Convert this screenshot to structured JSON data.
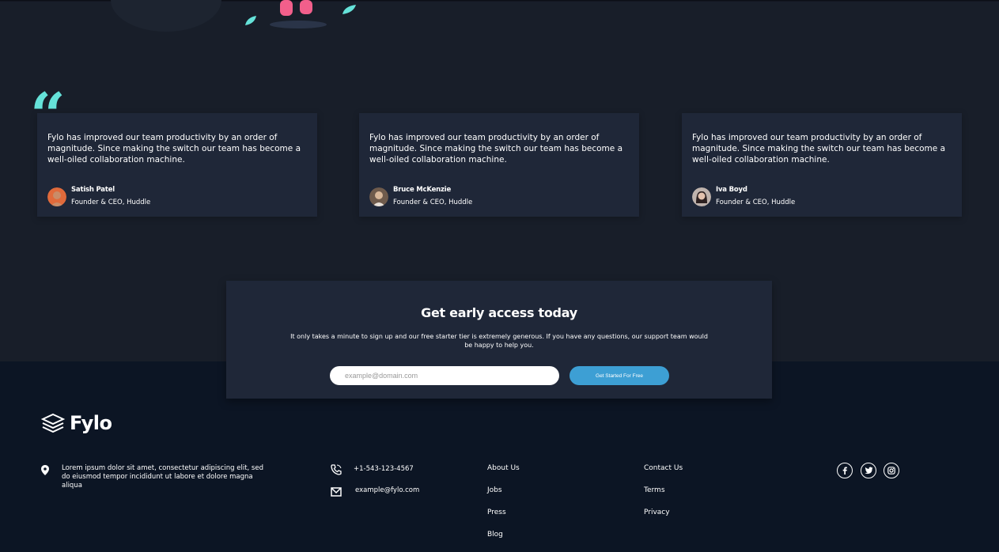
{
  "testimonials": [
    {
      "text": "Fylo has improved our team productivity by an order of magnitude. Since making the switch our team has become a well-oiled collaboration machine.",
      "name": "Satish Patel",
      "role": "Founder & CEO, Huddle"
    },
    {
      "text": "Fylo has improved our team productivity by an order of magnitude. Since making the switch our team has become a well-oiled collaboration machine.",
      "name": "Bruce McKenzie",
      "role": "Founder & CEO, Huddle"
    },
    {
      "text": "Fylo has improved our team productivity by an order of magnitude. Since making the switch our team has become a well-oiled collaboration machine.",
      "name": "Iva Boyd",
      "role": "Founder & CEO, Huddle"
    }
  ],
  "cta": {
    "title": "Get early access today",
    "description": "It only takes a minute to sign up and our free starter tier is extremely generous. If you have any questions, our support team would be happy to help you.",
    "email_placeholder": "example@domain.com",
    "button_label": "Get Started For Free"
  },
  "footer": {
    "logo_text": "Fylo",
    "address": "Lorem ipsum dolor sit amet, consectetur adipiscing elit, sed do eiusmod tempor incididunt ut labore et dolore magna aliqua",
    "phone": "+1-543-123-4567",
    "email": "example@fylo.com",
    "links_col1": [
      "About Us",
      "Jobs",
      "Press",
      "Blog"
    ],
    "links_col2": [
      "Contact Us",
      "Terms",
      "Privacy"
    ],
    "social": [
      "facebook-icon",
      "twitter-icon",
      "instagram-icon"
    ]
  },
  "colors": {
    "background": "#181e29",
    "card": "#1f2738",
    "footer": "#0c1524",
    "accent_teal": "#65e2d9",
    "button_blue": "#3d9fd4"
  }
}
